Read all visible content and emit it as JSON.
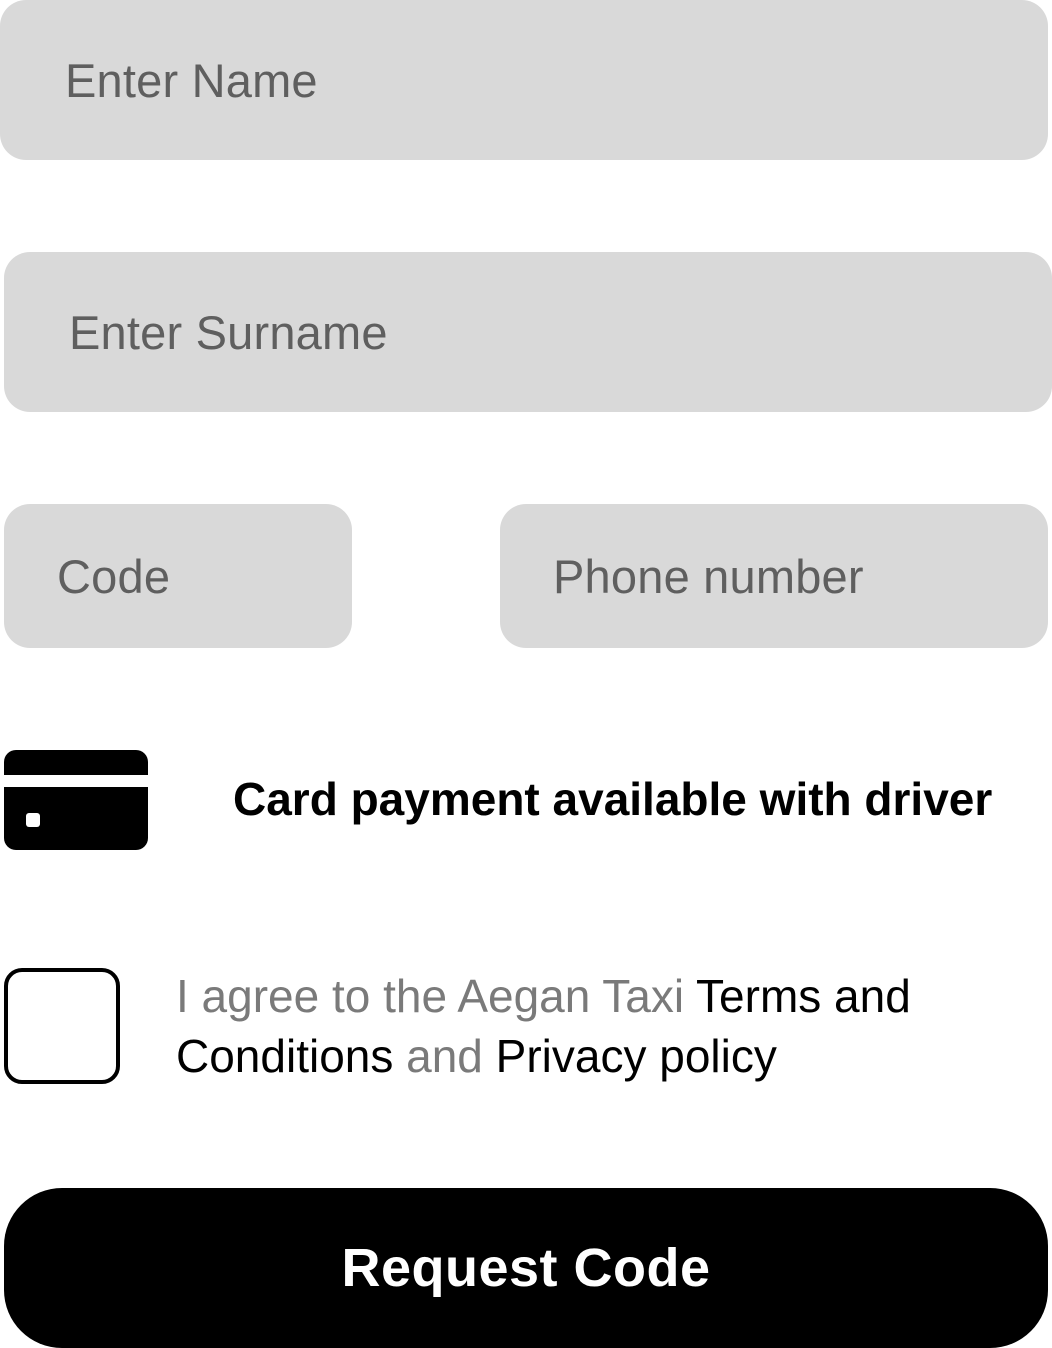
{
  "form": {
    "name_placeholder": "Enter Name",
    "surname_placeholder": "Enter Surname",
    "code_placeholder": "Code",
    "phone_placeholder": "Phone number"
  },
  "payment_notice": {
    "icon": "credit-card-icon",
    "text": "Card payment available with driver"
  },
  "agreement": {
    "checked": false,
    "prefix": "I agree to the Aegan Taxi ",
    "terms_link": "Terms and Conditions",
    "conjunction": " and ",
    "privacy_link": "Privacy policy"
  },
  "submit": {
    "label": "Request Code"
  },
  "colors": {
    "field_background": "#d9d9d9",
    "placeholder_text": "#5f5f5f",
    "muted_text": "#7a7a7a",
    "primary": "#000000",
    "button_text": "#ffffff"
  }
}
